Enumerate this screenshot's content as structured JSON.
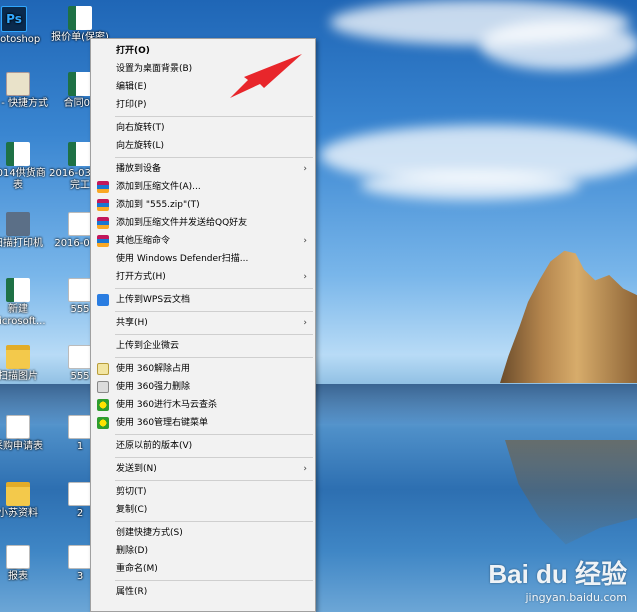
{
  "desktop_icons": [
    {
      "label": "Photoshop",
      "kind": "ps",
      "glyph": "Ps"
    },
    {
      "label": "报价单(保密)",
      "kind": "xl"
    },
    {
      "label": "图 - 快捷方式",
      "kind": "lnk"
    },
    {
      "label": "合同03",
      "kind": "xl"
    },
    {
      "label": "2014供货商表",
      "kind": "xl"
    },
    {
      "label": "2016-03工程完工",
      "kind": "xl"
    },
    {
      "label": "扫描打印机",
      "kind": "app"
    },
    {
      "label": "2016-03 1",
      "kind": "doc"
    },
    {
      "label": "新建 Microsoft...",
      "kind": "xl"
    },
    {
      "label": "555",
      "kind": "doc"
    },
    {
      "label": "扫描图片",
      "kind": "folder"
    },
    {
      "label": "555",
      "kind": "doc"
    },
    {
      "label": "采购申请表",
      "kind": "doc"
    },
    {
      "label": "1",
      "kind": "doc"
    },
    {
      "label": "小苏资料",
      "kind": "folder"
    },
    {
      "label": "2",
      "kind": "doc"
    },
    {
      "label": "报表",
      "kind": "doc"
    },
    {
      "label": "3",
      "kind": "doc"
    }
  ],
  "context_menu": {
    "items": [
      {
        "type": "item",
        "label": "打开(O)",
        "bold": true
      },
      {
        "type": "item",
        "label": "设置为桌面背景(B)"
      },
      {
        "type": "item",
        "label": "编辑(E)"
      },
      {
        "type": "item",
        "label": "打印(P)"
      },
      {
        "type": "sep"
      },
      {
        "type": "item",
        "label": "向右旋转(T)"
      },
      {
        "type": "item",
        "label": "向左旋转(L)"
      },
      {
        "type": "sep"
      },
      {
        "type": "item",
        "label": "播放到设备",
        "submenu": true
      },
      {
        "type": "item",
        "label": "添加到压缩文件(A)...",
        "icon": "rar"
      },
      {
        "type": "item",
        "label": "添加到 \"555.zip\"(T)",
        "icon": "rar"
      },
      {
        "type": "item",
        "label": "添加到压缩文件并发送给QQ好友",
        "icon": "rar"
      },
      {
        "type": "item",
        "label": "其他压缩命令",
        "icon": "rar",
        "submenu": true
      },
      {
        "type": "item",
        "label": "使用 Windows Defender扫描..."
      },
      {
        "type": "item",
        "label": "打开方式(H)",
        "submenu": true
      },
      {
        "type": "sep"
      },
      {
        "type": "item",
        "label": "上传到WPS云文档",
        "icon": "wps"
      },
      {
        "type": "sep"
      },
      {
        "type": "item",
        "label": "共享(H)",
        "submenu": true
      },
      {
        "type": "sep"
      },
      {
        "type": "item",
        "label": "上传到企业微云"
      },
      {
        "type": "sep"
      },
      {
        "type": "item",
        "label": "使用 360解除占用",
        "icon": "360a"
      },
      {
        "type": "item",
        "label": "使用 360强力删除",
        "icon": "360b"
      },
      {
        "type": "item",
        "label": "使用 360进行木马云查杀",
        "icon": "360c"
      },
      {
        "type": "item",
        "label": "使用 360管理右键菜单",
        "icon": "360c"
      },
      {
        "type": "sep"
      },
      {
        "type": "item",
        "label": "还原以前的版本(V)"
      },
      {
        "type": "sep"
      },
      {
        "type": "item",
        "label": "发送到(N)",
        "submenu": true
      },
      {
        "type": "sep"
      },
      {
        "type": "item",
        "label": "剪切(T)"
      },
      {
        "type": "item",
        "label": "复制(C)"
      },
      {
        "type": "sep"
      },
      {
        "type": "item",
        "label": "创建快捷方式(S)"
      },
      {
        "type": "item",
        "label": "删除(D)"
      },
      {
        "type": "item",
        "label": "重命名(M)"
      },
      {
        "type": "sep"
      },
      {
        "type": "item",
        "label": "属性(R)"
      }
    ]
  },
  "watermark": {
    "logo": "Bai du 经验",
    "sub": "jingyan.baidu.com"
  },
  "colors": {
    "annotation_arrow": "#e8262b"
  }
}
